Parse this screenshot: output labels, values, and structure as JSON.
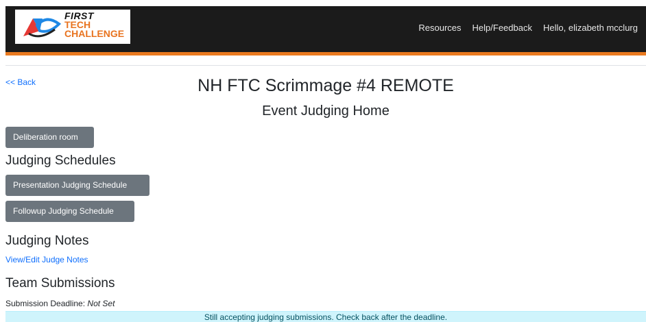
{
  "header": {
    "logo": {
      "line1": "FIRST",
      "line2": "TECH",
      "line3": "CHALLENGE"
    },
    "nav": {
      "resources": "Resources",
      "help": "Help/Feedback",
      "greeting": "Hello, elizabeth mcclurg"
    },
    "colors": {
      "bar": "#1b1b1b",
      "accent": "#ea7a1f"
    }
  },
  "back_link": "<< Back",
  "event": {
    "title": "NH FTC Scrimmage #4 REMOTE",
    "subtitle": "Event Judging Home"
  },
  "deliberation_button": "Deliberation room",
  "schedules": {
    "heading": "Judging Schedules",
    "presentation_button": "Presentation Judging Schedule",
    "followup_button": "Followup Judging Schedule"
  },
  "notes": {
    "heading": "Judging Notes",
    "link": "View/Edit Judge Notes"
  },
  "submissions": {
    "heading": "Team Submissions",
    "deadline_label": "Submission Deadline:",
    "deadline_value": "Not Set",
    "alert": "Still accepting judging submissions. Check back after the deadline."
  }
}
